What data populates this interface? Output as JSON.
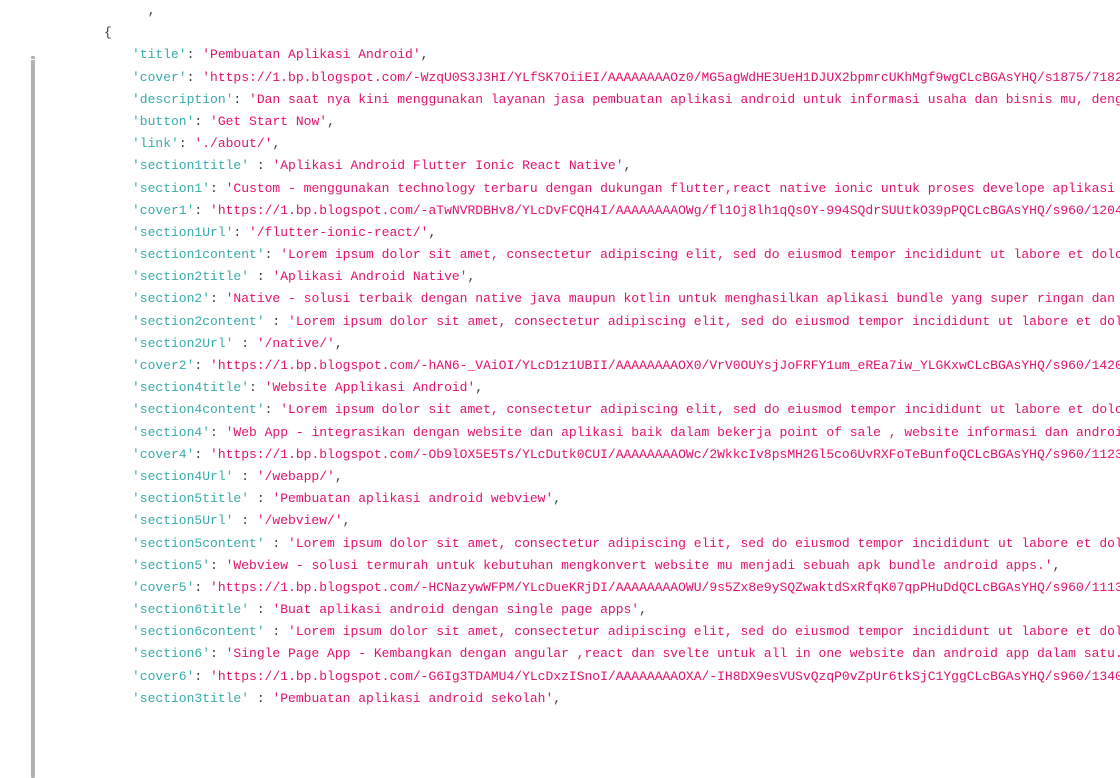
{
  "lines": [
    {
      "indent": 2,
      "raw": "  ,"
    },
    {
      "indent": 1,
      "raw": "{"
    },
    {
      "indent": 2,
      "key": "title",
      "value": "Pembuatan Aplikasi Android",
      "comma": true
    },
    {
      "indent": 2,
      "key": "cover",
      "value": "https://1.bp.blogspot.com/-WzqU0S3J3HI/YLfSK7OiiEI/AAAAAAAAOz0/MG5agWdHE3UeH1DJUX2bpmrcUKhMgf9wgCLcBGAsYHQ/s1875/7182874"
    },
    {
      "indent": 2,
      "key": "description",
      "value": "Dan saat nya kini menggunakan layanan jasa pembuatan aplikasi android untuk informasi usaha dan bisnis mu, dengan u"
    },
    {
      "indent": 2,
      "key": "button",
      "value": "Get Start Now",
      "comma": true
    },
    {
      "indent": 2,
      "key": "link",
      "value": "./about/",
      "comma": true
    },
    {
      "indent": 2,
      "key": "section1title",
      "pad": " ",
      "value": "Aplikasi Android Flutter Ionic React Native",
      "comma": true
    },
    {
      "indent": 2,
      "key": "section1",
      "value": "Custom - menggunakan technology terbaru dengan dukungan flutter,react native ionic untuk proses develope aplikasi and"
    },
    {
      "indent": 2,
      "key": "cover1",
      "value": "https://1.bp.blogspot.com/-aTwNVRDBHv8/YLcDvFCQH4I/AAAAAAAAOWg/fl1Oj8lh1qQsOY-994SQdrSUUtkO39pPQCLcBGAsYHQ/s960/1204268"
    },
    {
      "indent": 2,
      "key": "section1Url",
      "value": "/flutter-ionic-react/",
      "comma": true
    },
    {
      "indent": 2,
      "key": "section1content",
      "value": "Lorem ipsum dolor sit amet, consectetur adipiscing elit, sed do eiusmod tempor incididunt ut labore et dolore m"
    },
    {
      "indent": 2,
      "key": "section2title",
      "pad": " ",
      "value": "Aplikasi Android Native",
      "comma": true
    },
    {
      "indent": 2,
      "key": "section2",
      "value": "Native - solusi terbaik dengan native java maupun kotlin untuk menghasilkan aplikasi bundle yang super ringan dan kec"
    },
    {
      "indent": 2,
      "key": "section2content",
      "pad": " ",
      "value": "Lorem ipsum dolor sit amet, consectetur adipiscing elit, sed do eiusmod tempor incididunt ut labore et dolore "
    },
    {
      "indent": 2,
      "key": "section2Url",
      "pad": " ",
      "value": "/native/",
      "comma": true
    },
    {
      "indent": 2,
      "key": "cover2",
      "value": "https://1.bp.blogspot.com/-hAN6-_VAiOI/YLcD1z1UBII/AAAAAAAAOX0/VrV0OUYsjJoFRFY1um_eREa7iw_YLGKxwCLcBGAsYHQ/s960/1420313"
    },
    {
      "indent": 2,
      "key": "section4title",
      "value": "Website Applikasi Android",
      "comma": true
    },
    {
      "indent": 2,
      "key": "section4content",
      "value": "Lorem ipsum dolor sit amet, consectetur adipiscing elit, sed do eiusmod tempor incididunt ut labore et dolore m"
    },
    {
      "indent": 2,
      "key": "section4",
      "value": "Web App - integrasikan dengan website dan aplikasi baik dalam bekerja point of sale , website informasi dan android a"
    },
    {
      "indent": 2,
      "key": "cover4",
      "value": "https://1.bp.blogspot.com/-Ob9lOX5E5Ts/YLcDutk0CUI/AAAAAAAAOWc/2WkkcIv8psMH2Gl5co6UvRXFoTeBunfoQCLcBGAsYHQ/s960/1123065"
    },
    {
      "indent": 2,
      "key": "section4Url",
      "pad": " ",
      "value": "/webapp/",
      "comma": true
    },
    {
      "indent": 2,
      "key": "section5title",
      "pad": " ",
      "value": "Pembuatan aplikasi android webview",
      "comma": true
    },
    {
      "indent": 2,
      "key": "section5Url",
      "pad": " ",
      "value": "/webview/",
      "comma": true
    },
    {
      "indent": 2,
      "key": "section5content",
      "pad": " ",
      "value": "Lorem ipsum dolor sit amet, consectetur adipiscing elit, sed do eiusmod tempor incididunt ut labore et dolore "
    },
    {
      "indent": 2,
      "key": "section5",
      "value": "Webview - solusi termurah untuk kebutuhan mengkonvert website mu menjadi sebuah apk bundle android apps.",
      "comma": true
    },
    {
      "indent": 2,
      "key": "cover5",
      "value": "https://1.bp.blogspot.com/-HCNazywWFPM/YLcDueKRjDI/AAAAAAAAOWU/9s5Zx8e9ySQZwaktdSxRfqK07qpPHuDdQCLcBGAsYHQ/s960/1113016"
    },
    {
      "indent": 2,
      "key": "section6title",
      "pad": " ",
      "value": "Buat aplikasi android dengan single page apps",
      "comma": true
    },
    {
      "indent": 2,
      "key": "section6content",
      "pad": " ",
      "value": "Lorem ipsum dolor sit amet, consectetur adipiscing elit, sed do eiusmod tempor incididunt ut labore et dolore "
    },
    {
      "indent": 2,
      "key": "section6",
      "value": "Single Page App - Kembangkan dengan angular ,react dan svelte untuk all in one website dan android app dalam satu.",
      "comma": true
    },
    {
      "indent": 2,
      "key": "cover6",
      "value": "https://1.bp.blogspot.com/-G6Ig3TDAMU4/YLcDxzISnoI/AAAAAAAAOXA/-IH8DX9esVUSvQzqP0vZpUr6tkSjC1YggCLcBGAsYHQ/s960/1340680"
    },
    {
      "indent": 2,
      "key": "section3title",
      "pad": " ",
      "value": "Pembuatan aplikasi android sekolah",
      "comma": true
    }
  ]
}
